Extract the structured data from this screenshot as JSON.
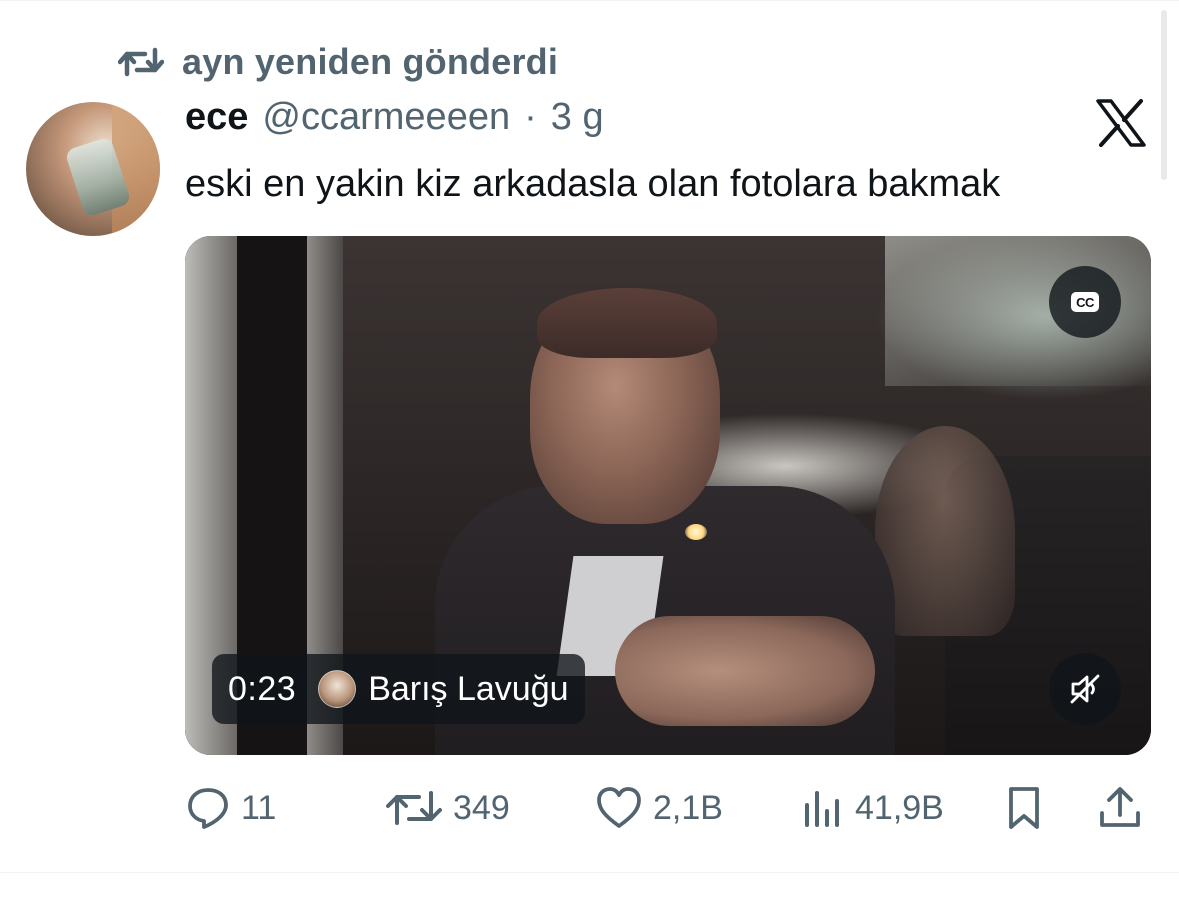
{
  "colors": {
    "text_primary": "#0f1419",
    "text_secondary": "#536471",
    "overlay_bg": "#0f1419",
    "divider": "#eff3f4"
  },
  "repost_context": {
    "icon": "repost-icon",
    "text": "ayn yeniden gönderdi"
  },
  "tweet": {
    "display_name": "ece",
    "handle": "@ccarmeeeen",
    "separator": "·",
    "time": "3 g",
    "brand_icon": "x-logo-icon",
    "text": "eski en yakin kiz arkadasla olan fotolara bakmak"
  },
  "media": {
    "type": "video",
    "captions_label": "CC",
    "captions_icon": "captions-icon",
    "mute_icon": "muted-speaker-icon",
    "duration": "0:23",
    "creator_name": "Barış Lavuğu"
  },
  "actions": {
    "reply": {
      "icon": "reply-icon",
      "count": "11"
    },
    "repost": {
      "icon": "repost-icon",
      "count": "349"
    },
    "like": {
      "icon": "heart-icon",
      "count": "2,1B"
    },
    "views": {
      "icon": "views-chart-icon",
      "count": "41,9B"
    },
    "bookmark": {
      "icon": "bookmark-icon"
    },
    "share": {
      "icon": "share-icon"
    }
  }
}
